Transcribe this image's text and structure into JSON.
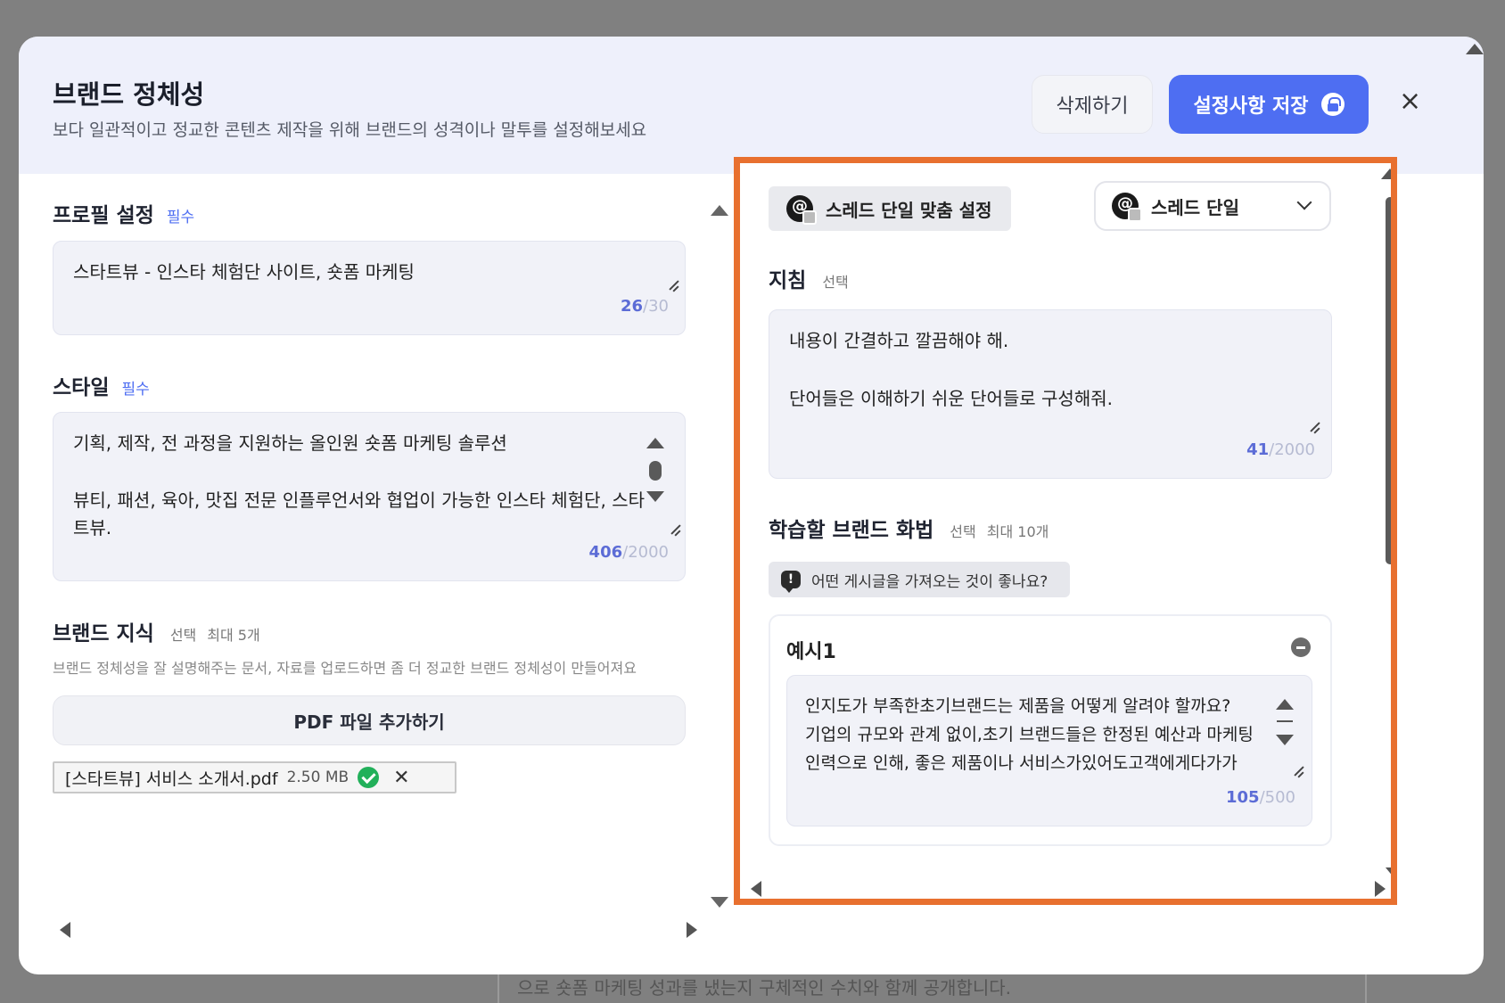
{
  "background_text": "으로 숏폼 마케팅 성과를 냈는지 구체적인 수치와 함께 공개합니다.",
  "header": {
    "title": "브랜드 정체성",
    "subtitle": "보다 일관적이고 정교한 콘텐츠 제작을 위해 브랜드의 성격이나 말투를 설정해보세요",
    "delete_label": "삭제하기",
    "save_label": "설정사항 저장",
    "close_icon": "×"
  },
  "profile": {
    "label": "프로필 설정",
    "required": "필수",
    "value": "스타트뷰 - 인스타 체험단 사이트, 숏폼 마케팅",
    "count": "26",
    "max": "/30"
  },
  "style": {
    "label": "스타일",
    "required": "필수",
    "line1": "기획, 제작, 전 과정을 지원하는 올인원 숏폼 마케팅 솔루션",
    "line2": "뷰티, 패션, 육아, 맛집 전문 인플루언서와 협업이 가능한 인스타 체험단, 스타",
    "line3": "트뷰.",
    "count": "406",
    "max": "/2000"
  },
  "knowledge": {
    "label": "브랜드 지식",
    "optional": "선택",
    "limit": "최대 5개",
    "hint": "브랜드 정체성을 잘 설명해주는 문서, 자료를 업로드하면 좀 더 정교한 브랜드 정체성이 만들어져요",
    "pdf_button": "PDF 파일 추가하기",
    "file_name": "[스타트뷰] 서비스 소개서.pdf",
    "file_size": "2.50 MB"
  },
  "right": {
    "chip_label": "스레드 단일 맞춤 설정",
    "dropdown_value": "스레드 단일",
    "guide_label": "지침",
    "guide_optional": "선택",
    "guide_line1": "내용이 간결하고 깔끔해야 해.",
    "guide_line2": "단어들은 이해하기 쉬운 단어들로 구성해줘.",
    "guide_count": "41",
    "guide_max": "/2000",
    "speech_label": "학습할 브랜드 화법",
    "speech_optional": "선택",
    "speech_limit": "최대 10개",
    "tip": "어떤 게시글을 가져오는 것이 좋나요?",
    "example_title": "예시1",
    "example_line1": "인지도가 부족한초기브랜드는 제품을 어떻게 알려야 할까요?",
    "example_line2": "기업의 규모와 관계 없이,초기 브랜드들은 한정된 예산과 마케팅",
    "example_line3": "인력으로 인해, 좋은 제품이나 서비스가있어도고객에게다가가",
    "example_count": "105",
    "example_max": "/500"
  },
  "colors": {
    "accent": "#4e6ef2",
    "highlight_border": "#e8702f",
    "success": "#22b05a"
  }
}
